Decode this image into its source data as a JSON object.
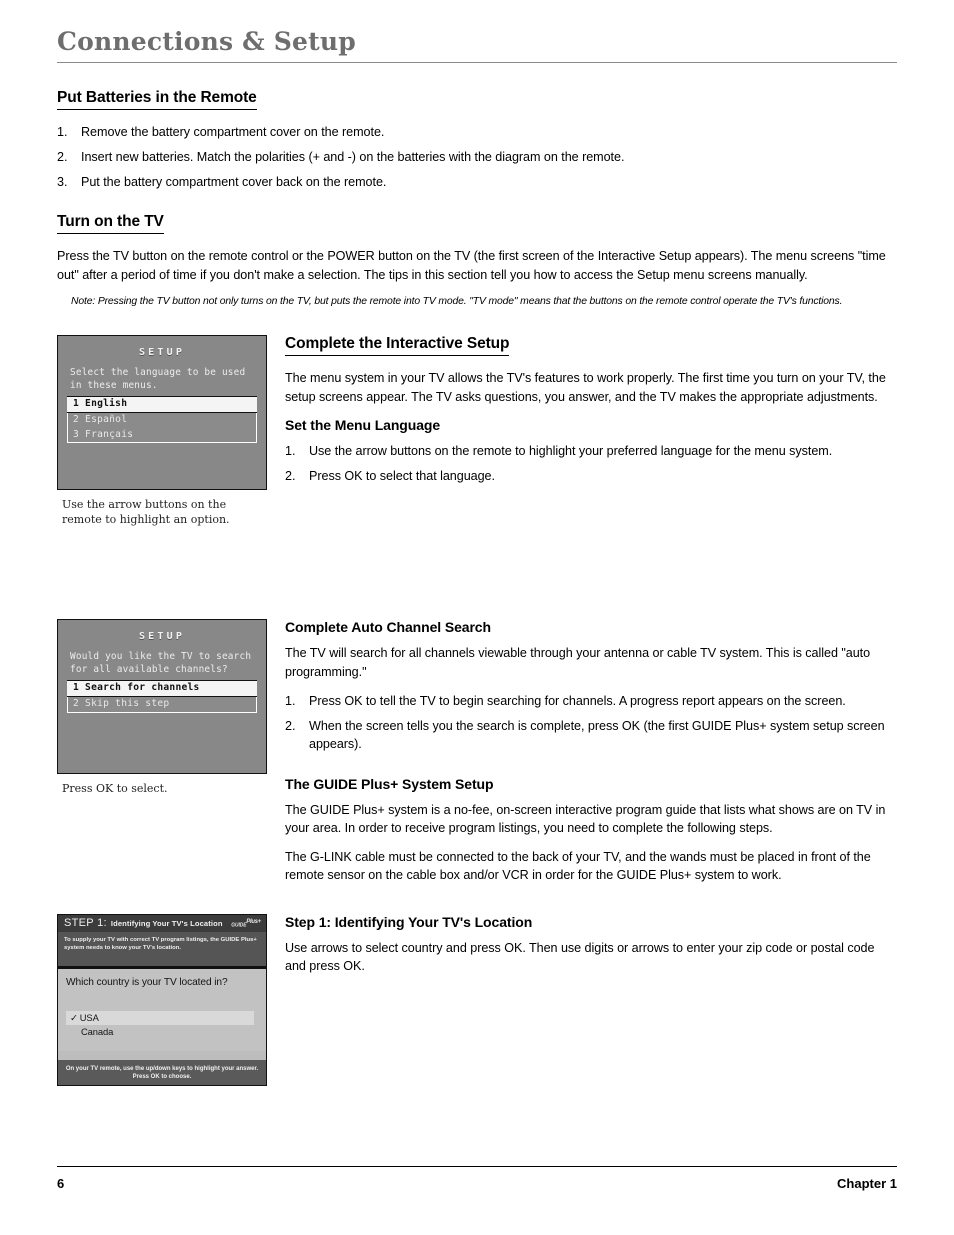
{
  "header": {
    "title": "Connections & Setup"
  },
  "batteries": {
    "heading": "Put Batteries in the Remote",
    "steps": [
      {
        "num": "1.",
        "text": "Remove the battery compartment cover on the remote."
      },
      {
        "num": "2.",
        "text": "Insert new batteries. Match the polarities (+ and -) on the batteries with the diagram on the remote."
      },
      {
        "num": "3.",
        "text": "Put the battery compartment cover back on the remote."
      }
    ]
  },
  "turn_on": {
    "heading": "Turn on the TV",
    "body": "Press the TV button on the remote control or the POWER button on the TV (the first screen of the Interactive Setup appears). The menu screens \"time out\" after a period of time if you don't make a selection. The tips in this section tell you how to access the Setup menu screens manually.",
    "note": "Note: Pressing the TV button not only turns on the TV, but puts the remote into TV mode. \"TV mode\" means that the buttons on the remote control operate the TV's functions."
  },
  "language_screen": {
    "title": "SETUP",
    "prompt": "Select the language to be used in these menus.",
    "options": [
      {
        "label": "1 English",
        "selected": true
      },
      {
        "label": "2 Español",
        "selected": false
      },
      {
        "label": "3 Français",
        "selected": false
      }
    ],
    "caption": "Use the arrow buttons on the remote to highlight an option."
  },
  "interactive_setup": {
    "heading": "Complete the Interactive Setup",
    "body": "The menu system in your TV allows the TV's features to work properly. The first time you turn on your TV, the setup screens appear. The TV asks questions, you answer, and the TV makes the appropriate adjustments.",
    "subheading": "Set the Menu Language",
    "steps": [
      {
        "num": "1.",
        "text": "Use the arrow buttons on the remote to highlight your preferred language for the menu system."
      },
      {
        "num": "2.",
        "text": "Press OK to select that language."
      }
    ]
  },
  "search_screen": {
    "title": "SETUP",
    "prompt": "Would you like the TV to search for all available channels?",
    "options": [
      {
        "label": "1 Search for channels",
        "selected": true
      },
      {
        "label": "2 Skip this step",
        "selected": false
      }
    ],
    "caption": "Press OK to select."
  },
  "auto_search": {
    "heading": "Complete Auto Channel Search",
    "body": "The TV will search for all channels viewable through your antenna or cable TV system. This is called \"auto programming.\"",
    "steps": [
      {
        "num": "1.",
        "text": "Press OK to tell the TV to begin searching for channels. A progress report appears on the screen."
      },
      {
        "num": "2.",
        "text": "When the screen tells you the search is complete, press OK (the first GUIDE Plus+ system setup screen appears)."
      }
    ]
  },
  "guide_plus": {
    "heading": "The GUIDE Plus+ System Setup",
    "paragraph1": "The GUIDE Plus+ system is a no-fee, on-screen interactive program guide that lists what shows are on TV in your area. In order to receive program listings, you need to complete the following steps.",
    "paragraph2": "The G-LINK cable must be connected to the back of your TV, and the wands must be placed in front of the remote sensor on the cable box and/or VCR in order for the GUIDE Plus+ system to work."
  },
  "guide_screen": {
    "step_label": "STEP 1:",
    "head_title": "Identifying Your TV's Location",
    "logo": "GUIDE",
    "logo_suffix": "Plus+",
    "intro": "To supply your TV with correct TV program listings, the GUIDE Plus+ system needs to know your TV's location.",
    "question": "Which country is your TV located in?",
    "choices": [
      {
        "label": "USA",
        "selected": true,
        "check": "✓"
      },
      {
        "label": "Canada",
        "selected": false,
        "check": ""
      }
    ],
    "footer_line1": "On your TV remote, use the up/down keys to highlight your answer.",
    "footer_line2": "Press OK to choose."
  },
  "step1": {
    "heading": "Step 1: Identifying Your TV's Location",
    "body": "Use arrows to select country and press OK. Then use digits or arrows to enter your zip code or postal code and press OK."
  },
  "footer": {
    "page_number": "6",
    "chapter": "Chapter 1"
  }
}
